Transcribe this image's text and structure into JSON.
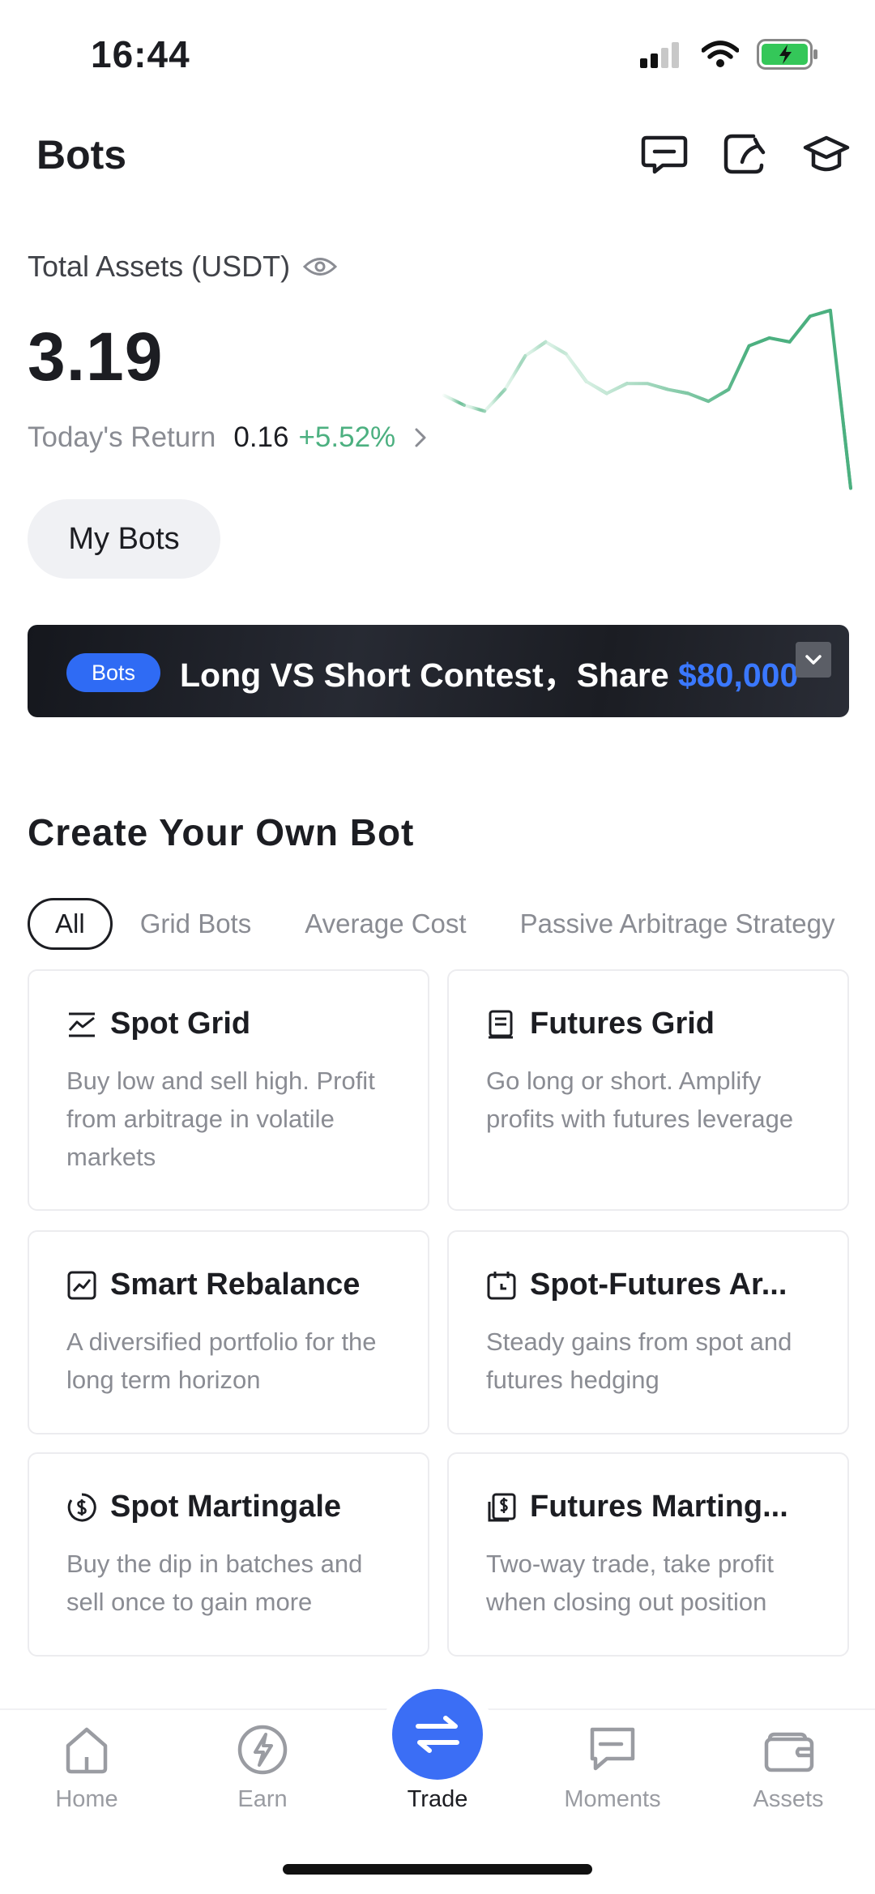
{
  "status_bar": {
    "time": "16:44"
  },
  "header": {
    "title": "Bots",
    "icons": [
      "message-icon",
      "share-icon",
      "academy-icon"
    ]
  },
  "assets": {
    "label": "Total Assets (USDT)",
    "value": "3.19",
    "return_label": "Today's Return",
    "return_amount": "0.16",
    "return_pct": "+5.52%"
  },
  "my_bots_button": "My Bots",
  "chart_data": {
    "type": "line",
    "values": [
      0.55,
      0.5,
      0.47,
      0.58,
      0.75,
      0.82,
      0.76,
      0.62,
      0.56,
      0.61,
      0.61,
      0.58,
      0.56,
      0.52,
      0.58,
      0.8,
      0.84,
      0.82,
      0.95,
      0.98,
      0.08
    ],
    "colors": {
      "line": "#4cb080",
      "fade": "#d6efe2"
    }
  },
  "banner": {
    "badge": "Bots",
    "text": "Long VS Short Contest，Share ",
    "highlight": "$80,000"
  },
  "section_title": "Create Your Own Bot",
  "filter_tabs": [
    "All",
    "Grid Bots",
    "Average Cost",
    "Passive Arbitrage Strategy"
  ],
  "cards": [
    {
      "title": "Spot Grid",
      "desc": "Buy low and sell high. Profit from arbitrage in volatile markets",
      "icon": "spot-grid-icon"
    },
    {
      "title": "Futures Grid",
      "desc": "Go long or short. Amplify profits with futures leverage",
      "icon": "futures-grid-icon"
    },
    {
      "title": "Smart Rebalance",
      "desc": "A diversified portfolio for the long term horizon",
      "icon": "rebalance-icon"
    },
    {
      "title": "Spot-Futures Ar...",
      "desc": "Steady gains from spot and futures hedging",
      "icon": "calendar-icon"
    },
    {
      "title": "Spot Martingale",
      "desc": "Buy the dip in batches and sell once to gain more",
      "icon": "dollar-circle-icon"
    },
    {
      "title": "Futures Marting...",
      "desc": "Two-way trade, take profit when closing out position",
      "icon": "dollar-doc-icon"
    }
  ],
  "bottom_nav": [
    {
      "label": "Home",
      "icon": "home-icon"
    },
    {
      "label": "Earn",
      "icon": "earn-icon"
    },
    {
      "label": "Trade",
      "icon": "trade-icon"
    },
    {
      "label": "Moments",
      "icon": "moments-icon"
    },
    {
      "label": "Assets",
      "icon": "wallet-icon"
    }
  ],
  "colors": {
    "accent": "#3b6ef5",
    "positive": "#4cb080"
  }
}
